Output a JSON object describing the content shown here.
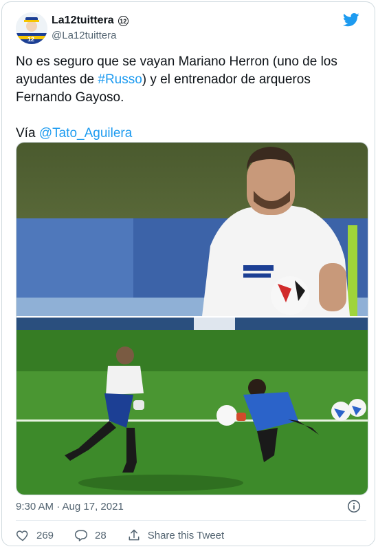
{
  "tweet": {
    "display_name": "La12tuittera",
    "badge_text": "12",
    "handle": "@La12tuittera",
    "text_line1_a": "No es seguro que se vayan Mariano Herron (uno de los ayudantes de ",
    "hashtag": "#Russo",
    "text_line1_b": ") y el entrenador de arqueros Fernando Gayoso.",
    "via_prefix": "Vía ",
    "mention": "@Tato_Aguilera",
    "timestamp": "9:30 AM · Aug 17, 2021",
    "likes": "269",
    "replies": "28",
    "share_label": "Share this Tweet"
  },
  "colors": {
    "link": "#1d9bf0",
    "muted": "#536471",
    "twitter_blue": "#1d9bf0"
  },
  "icons": {
    "logo": "twitter-bird-icon",
    "info": "info-icon",
    "like": "heart-icon",
    "reply": "reply-icon",
    "share": "share-icon"
  }
}
